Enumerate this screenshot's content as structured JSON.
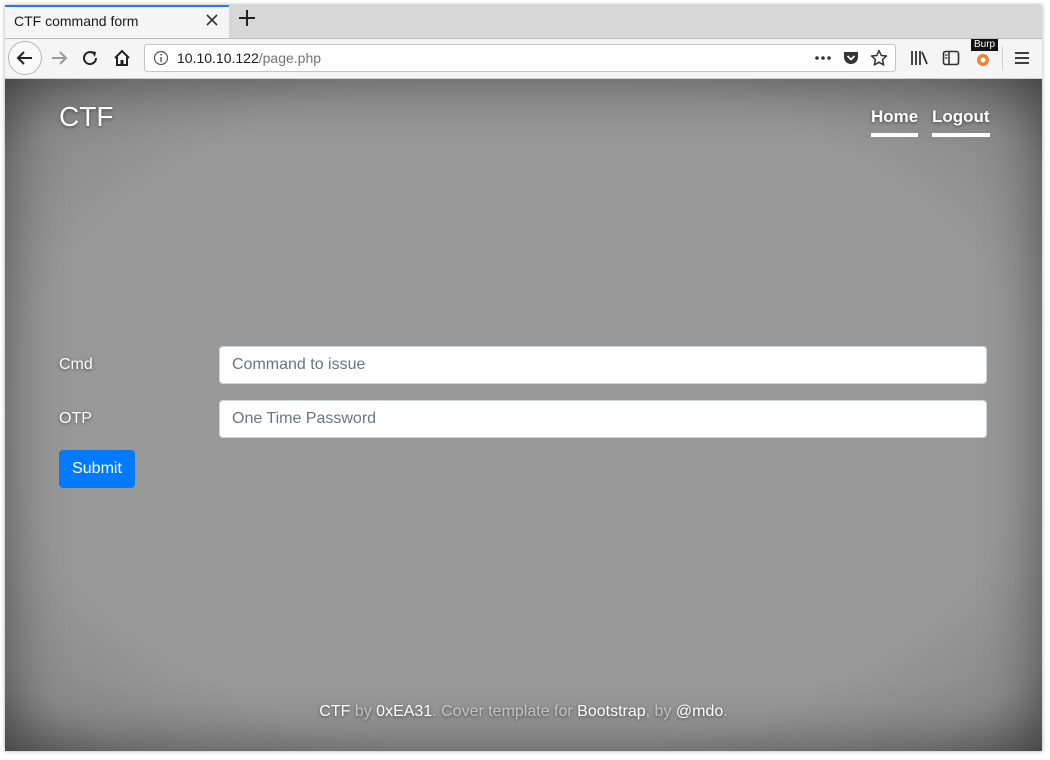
{
  "browser": {
    "tab_title": "CTF command form",
    "url_host": "10.10.10.122",
    "url_path": "/page.php",
    "burp_label": "Burp",
    "accent_color": "#0a84ff"
  },
  "site": {
    "brand": "CTF",
    "nav": [
      "Home",
      "Logout"
    ]
  },
  "form": {
    "cmd_label": "Cmd",
    "cmd_placeholder": "Command to issue",
    "cmd_value": "",
    "otp_label": "OTP",
    "otp_placeholder": "One Time Password",
    "otp_value": "",
    "submit_label": "Submit",
    "submit_color": "#007bff"
  },
  "footer": {
    "link1": "CTF",
    "text1": " by ",
    "link2": "0xEA31",
    "text2": ". Cover template for ",
    "link3": "Bootstrap",
    "text3": ", by ",
    "link4": "@mdo",
    "text4": "."
  },
  "icons": {
    "back": "arrow-left-icon",
    "forward": "arrow-right-icon",
    "reload": "reload-icon",
    "home": "home-icon",
    "info": "info-icon",
    "more": "more-actions-icon",
    "pocket": "pocket-icon",
    "bookmark": "star-icon",
    "library": "library-icon",
    "sidebar": "sidebar-icon",
    "burp": "burp-extension-icon",
    "menu": "hamburger-menu-icon"
  }
}
